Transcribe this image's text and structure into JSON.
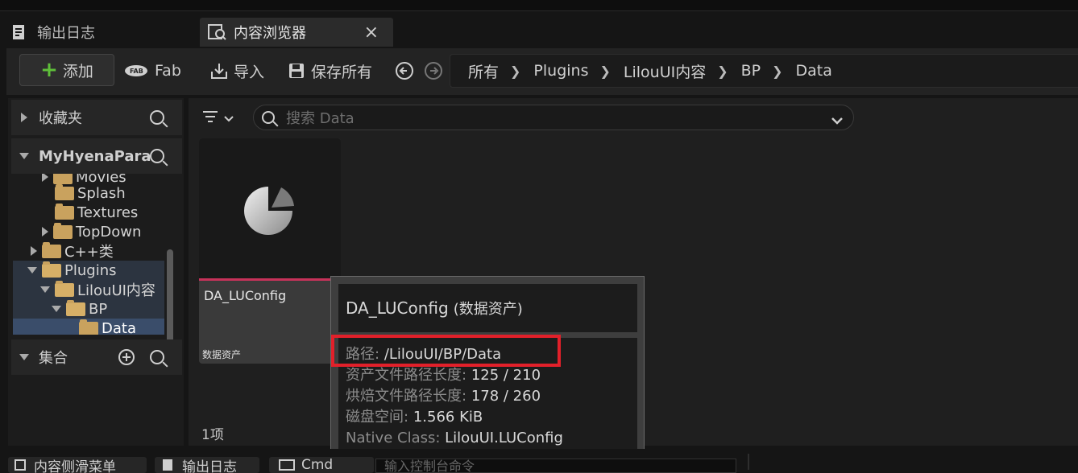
{
  "tabs": [
    {
      "label": "输出日志",
      "icon": "output-log-icon"
    },
    {
      "label": "内容浏览器",
      "icon": "content-browser-icon",
      "close": "×"
    }
  ],
  "toolbar": {
    "add_label": "添加",
    "fab_label": "Fab",
    "import_label": "导入",
    "save_all_label": "保存所有",
    "breadcrumbs": [
      "所有",
      "Plugins",
      "LilouUI内容",
      "BP",
      "Data"
    ]
  },
  "sidebar": {
    "favorites_label": "收藏夹",
    "project_label": "MyHyenaPara",
    "tree": [
      {
        "label": "Movies",
        "indent": 1
      },
      {
        "label": "Splash",
        "indent": 2
      },
      {
        "label": "Textures",
        "indent": 2
      },
      {
        "label": "TopDown",
        "indent": 2
      },
      {
        "label": "C++类",
        "indent": 1
      },
      {
        "label": "Plugins",
        "indent": 1
      },
      {
        "label": "LilouUI内容",
        "indent": 2
      },
      {
        "label": "BP",
        "indent": 3
      },
      {
        "label": "Data",
        "indent": 4
      }
    ],
    "collections_label": "集合"
  },
  "main": {
    "search_placeholder": "搜索 Data",
    "item_count": "1项",
    "asset": {
      "name": "DA_LUConfig",
      "type": "数据资产"
    }
  },
  "tooltip": {
    "title": "DA_LUConfig",
    "title_type": "(数据资产)",
    "rows": [
      {
        "key": "路径:",
        "value": "/LilouUI/BP/Data"
      },
      {
        "key": "资产文件路径长度:",
        "value": "125 / 210"
      },
      {
        "key": "烘焙文件路径长度:",
        "value": "178 / 260"
      },
      {
        "key": "磁盘空间:",
        "value": "1.566 KiB"
      },
      {
        "key": "Native Class:",
        "value": "LilouUI.LUConfig"
      }
    ]
  },
  "bottom": {
    "drawer_label": "内容侧滑菜单",
    "output_label": "输出日志",
    "cmd_label": "Cmd",
    "console_placeholder": "输入控制台命令"
  },
  "colors": {
    "accent_add": "#5fbf3a",
    "data_asset": "#c8325a",
    "highlight": "#e2202a"
  }
}
